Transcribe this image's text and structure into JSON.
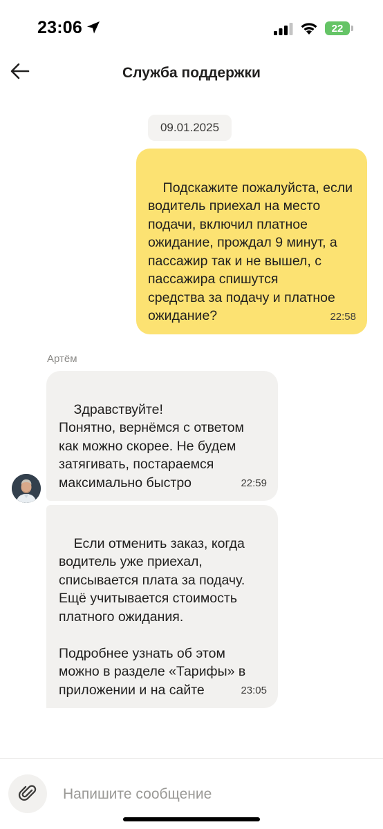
{
  "status_bar": {
    "time": "23:06",
    "battery": "22",
    "icons": [
      "location-arrow-icon",
      "cellular-signal-icon",
      "wifi-icon",
      "battery-icon"
    ]
  },
  "header": {
    "title": "Служба поддержки",
    "back_icon": "arrow-left-icon"
  },
  "chat": {
    "date": "09.01.2025",
    "messages": [
      {
        "direction": "outgoing",
        "text": "Подскажите пожалуйста, если\nводитель приехал на место\nподачи, включил платное\nожидание, прождал 9 минут, а\nпассажир так и не вышел, с\nпассажира спишутся\nсредства за подачу и платное\nожидание?",
        "time": "22:58"
      },
      {
        "direction": "incoming",
        "sender": "Артём",
        "text": "Здравствуйте!\nПонятно, вернёмся с ответом\nкак можно скорее. Не будем\nзатягивать, постараемся\nмаксимально быстро",
        "time": "22:59"
      },
      {
        "direction": "incoming",
        "text": "Если отменить заказ, когда\nводитель уже приехал,\nсписывается плата за подачу.\nЕщё учитывается стоимость\nплатного ожидания.\n\nПодробнее узнать об этом\nможно в разделе «Тарифы» в\nприложении и на сайте",
        "time": "23:05"
      }
    ]
  },
  "composer": {
    "placeholder": "Напишите сообщение",
    "value": "",
    "attach_icon": "paperclip-icon"
  },
  "colors": {
    "outgoing_bubble": "#fce272",
    "incoming_bubble": "#f2f1ef",
    "battery": "#65c466"
  }
}
